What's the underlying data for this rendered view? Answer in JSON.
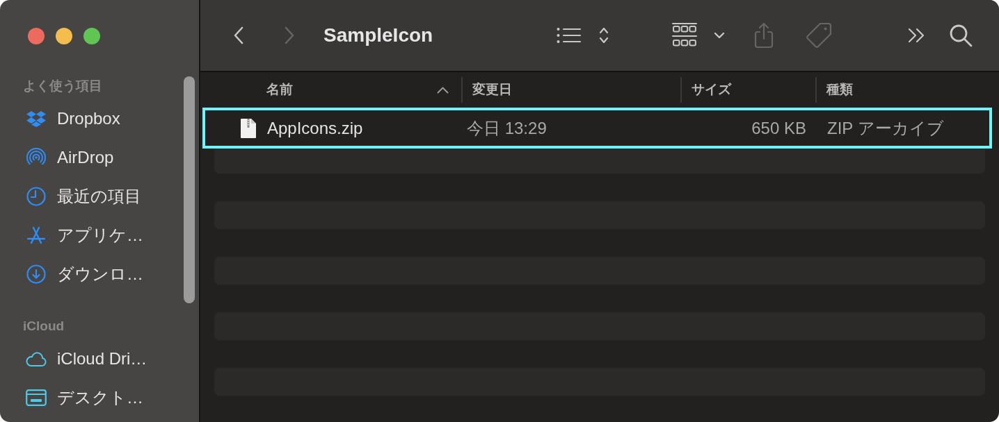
{
  "window": {
    "title": "SampleIcon"
  },
  "navigation": [
    {
      "kind": "back",
      "disabled": false
    },
    {
      "kind": "forward",
      "disabled": true
    }
  ],
  "toolbar": [
    {
      "kind": "list-view",
      "disabled": false
    },
    {
      "kind": "group",
      "disabled": false
    },
    {
      "kind": "share",
      "disabled": true
    },
    {
      "kind": "tag",
      "disabled": true
    },
    {
      "kind": "more",
      "disabled": false
    },
    {
      "kind": "search",
      "disabled": false
    }
  ],
  "sidebar": {
    "sections": [
      {
        "heading": "よく使う項目",
        "items": [
          {
            "label": "Dropbox"
          },
          {
            "label": "AirDrop"
          },
          {
            "label": "最近の項目"
          },
          {
            "label": "アプリケ…"
          },
          {
            "label": "ダウンロ…"
          }
        ]
      },
      {
        "heading": "iCloud",
        "items": [
          {
            "label": "iCloud Dri…"
          },
          {
            "label": "デスクト…"
          }
        ]
      }
    ]
  },
  "table": {
    "columns": [
      {
        "label": "名前",
        "sorted": true
      },
      {
        "label": "変更日",
        "sorted": false
      },
      {
        "label": "サイズ",
        "sorted": false
      },
      {
        "label": "種類",
        "sorted": false
      }
    ],
    "rows": [
      {
        "cells": [
          "AppIcons.zip",
          "今日 13:29",
          "650 KB",
          "ZIP アーカイブ"
        ],
        "highlighted": true
      }
    ]
  }
}
